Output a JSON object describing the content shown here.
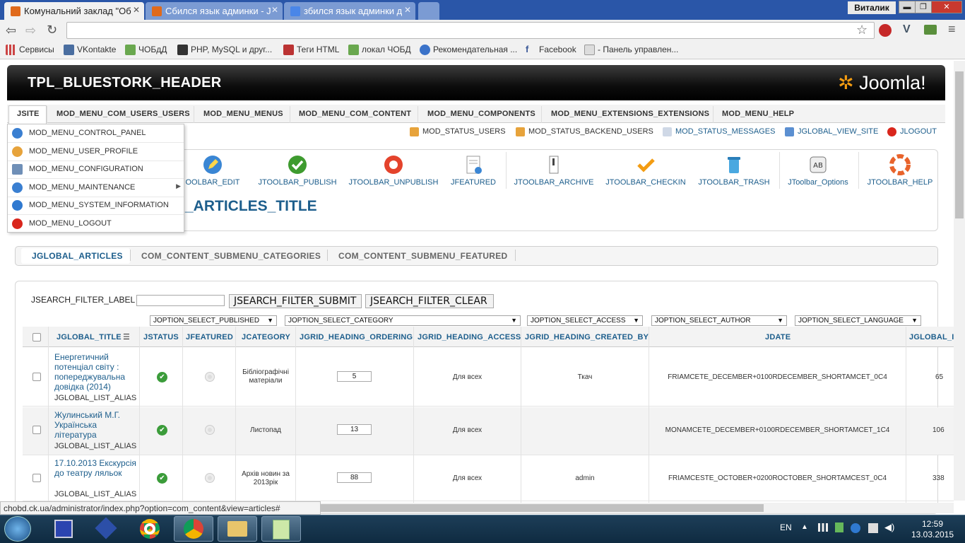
{
  "browser": {
    "tabs": [
      {
        "label": "Комунальний заклад \"Об"
      },
      {
        "label": "Сбился язык админки - J"
      },
      {
        "label": "збился язык админки д"
      }
    ],
    "user": "Виталик",
    "window_buttons": {
      "minimize": "▬",
      "maximize": "❐",
      "close": "✕"
    },
    "bookmarks": [
      {
        "label": "Сервисы"
      },
      {
        "label": "VKontakte"
      },
      {
        "label": "ЧОБдД"
      },
      {
        "label": "PHP, MySQL и друг..."
      },
      {
        "label": "Теги HTML"
      },
      {
        "label": "локал ЧОБД"
      },
      {
        "label": "Рекомендательная ..."
      },
      {
        "label": "Facebook"
      },
      {
        "label": "- Панель управлен..."
      }
    ],
    "status_url": "chobd.ck.ua/administrator/index.php?option=com_content&view=articles#"
  },
  "header": {
    "title": "TPL_BLUESTORK_HEADER",
    "logo": "Joomla!"
  },
  "menu": {
    "items": [
      "JSITE",
      "MOD_MENU_COM_USERS_USERS",
      "MOD_MENU_MENUS",
      "MOD_MENU_COM_CONTENT",
      "MOD_MENU_COMPONENTS",
      "MOD_MENU_EXTENSIONS_EXTENSIONS",
      "MOD_MENU_HELP"
    ],
    "dropdown": [
      "MOD_MENU_CONTROL_PANEL",
      "MOD_MENU_USER_PROFILE",
      "MOD_MENU_CONFIGURATION",
      "MOD_MENU_MAINTENANCE",
      "MOD_MENU_SYSTEM_INFORMATION",
      "MOD_MENU_LOGOUT"
    ]
  },
  "status": [
    "MOD_STATUS_USERS",
    "MOD_STATUS_BACKEND_USERS",
    "MOD_STATUS_MESSAGES",
    "JGLOBAL_VIEW_SITE",
    "JLOGOUT"
  ],
  "toolbar": [
    "OOLBAR_EDIT",
    "JTOOLBAR_PUBLISH",
    "JTOOLBAR_UNPUBLISH",
    "JFEATURED",
    "JTOOLBAR_ARCHIVE",
    "JTOOLBAR_CHECKIN",
    "JTOOLBAR_TRASH",
    "JToolbar_Options",
    "JTOOLBAR_HELP"
  ],
  "page_title": "_ARTICLES_TITLE",
  "submenu": [
    "JGLOBAL_ARTICLES",
    "COM_CONTENT_SUBMENU_CATEGORIES",
    "COM_CONTENT_SUBMENU_FEATURED"
  ],
  "filter": {
    "label": "JSEARCH_FILTER_LABEL",
    "value": "",
    "submit": "JSEARCH_FILTER_SUBMIT",
    "clear": "JSEARCH_FILTER_CLEAR",
    "selects": [
      "JOPTION_SELECT_PUBLISHED",
      "JOPTION_SELECT_CATEGORY",
      "JOPTION_SELECT_ACCESS",
      "JOPTION_SELECT_AUTHOR",
      "JOPTION_SELECT_LANGUAGE"
    ]
  },
  "table": {
    "headers": [
      "JGLOBAL_TITLE",
      "JSTATUS",
      "JFEATURED",
      "JCATEGORY",
      "JGRID_HEADING_ORDERING",
      "JGRID_HEADING_ACCESS",
      "JGRID_HEADING_CREATED_BY",
      "JDATE",
      "JGLOBAL_I"
    ],
    "rows": [
      {
        "title": "Енергетичний потенціал світу : попереджувальна довідка (2014)",
        "alias": "JGLOBAL_LIST_ALIAS",
        "category": "Бібліографічні матеріали",
        "ordering": "5",
        "access": "Для всех",
        "created_by": "Ткач",
        "date": "FRIAMCETE_DECEMBER+0100RDECEMBER_SHORTAMCET_0C4",
        "id": "65"
      },
      {
        "title": "Жулинський М.Г. Українська література",
        "alias": "JGLOBAL_LIST_ALIAS",
        "category": "Листопад",
        "ordering": "13",
        "access": "Для всех",
        "created_by": "",
        "date": "MONAMCETE_DECEMBER+0100RDECEMBER_SHORTAMCET_1C4",
        "id": "106"
      },
      {
        "title": "17.10.2013 Екскурсія до театру ляльок",
        "alias": "JGLOBAL_LIST_ALIAS",
        "category": "Архів новин за 2013рік",
        "ordering": "88",
        "access": "Для всех",
        "created_by": "admin",
        "date": "FRIAMCESTE_OCTOBER+0200ROCTOBER_SHORTAMCEST_0C4",
        "id": "338"
      }
    ]
  },
  "taskbar": {
    "lang": "EN",
    "time": "12:59",
    "date": "13.03.2015"
  },
  "colors": {
    "link": "#1d5e8c",
    "header_bg": "#000000",
    "taskbar_bg": "#1d3e58"
  }
}
